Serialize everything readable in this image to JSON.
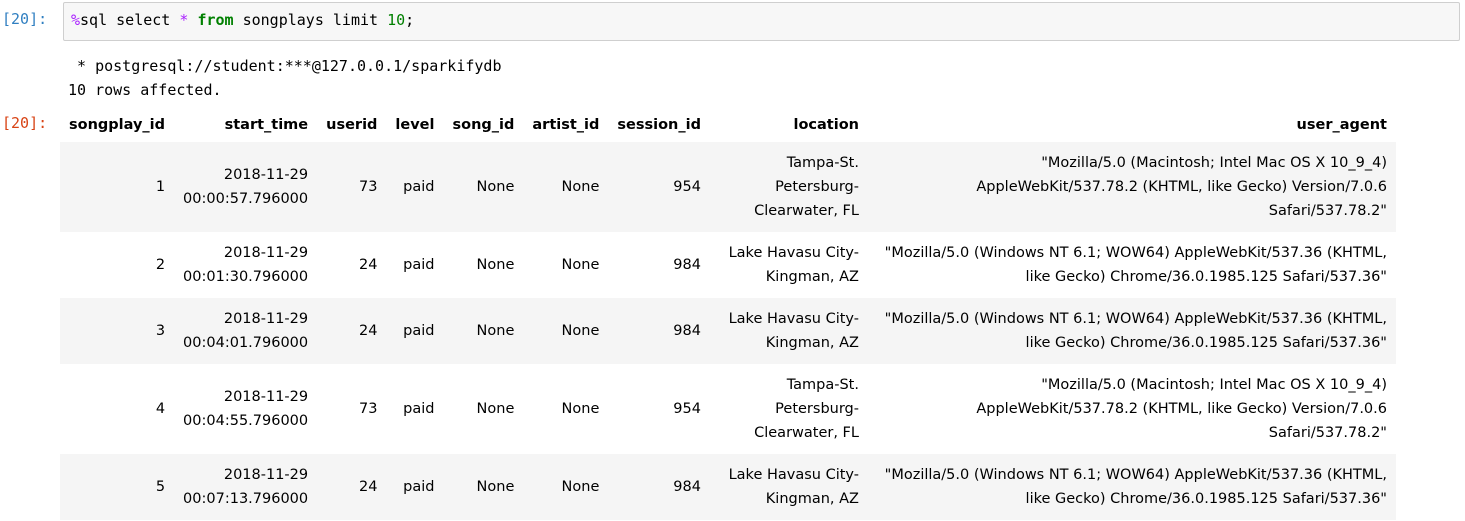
{
  "input_cell": {
    "prompt": "[20]:",
    "code_tokens": [
      {
        "cls": "tk-magic",
        "text": "%"
      },
      {
        "cls": "",
        "text": "sql select "
      },
      {
        "cls": "tk-op",
        "text": "*"
      },
      {
        "cls": "",
        "text": " "
      },
      {
        "cls": "tk-kw",
        "text": "from"
      },
      {
        "cls": "",
        "text": " songplays limit "
      },
      {
        "cls": "tk-num",
        "text": "10"
      },
      {
        "cls": "",
        "text": ";"
      }
    ]
  },
  "output_cell": {
    "prompt": "[20]:",
    "connection": " * postgresql://student:***@127.0.0.1/sparkifydb",
    "rows_affected": "10 rows affected."
  },
  "table": {
    "columns": [
      "songplay_id",
      "start_time",
      "userid",
      "level",
      "song_id",
      "artist_id",
      "session_id",
      "location",
      "user_agent"
    ],
    "rows": [
      {
        "lines": 3,
        "cells": [
          "1",
          "2018-11-29 00:00:57.796000",
          "73",
          "paid",
          "None",
          "None",
          "954",
          "Tampa-St. Petersburg-Clearwater, FL",
          "\"Mozilla/5.0 (Macintosh; Intel Mac OS X 10_9_4) AppleWebKit/537.78.2 (KHTML, like Gecko) Version/7.0.6 Safari/537.78.2\""
        ]
      },
      {
        "lines": 2,
        "cells": [
          "2",
          "2018-11-29 00:01:30.796000",
          "24",
          "paid",
          "None",
          "None",
          "984",
          "Lake Havasu City-Kingman, AZ",
          "\"Mozilla/5.0 (Windows NT 6.1; WOW64) AppleWebKit/537.36 (KHTML, like Gecko) Chrome/36.0.1985.125 Safari/537.36\""
        ]
      },
      {
        "lines": 2,
        "cells": [
          "3",
          "2018-11-29 00:04:01.796000",
          "24",
          "paid",
          "None",
          "None",
          "984",
          "Lake Havasu City-Kingman, AZ",
          "\"Mozilla/5.0 (Windows NT 6.1; WOW64) AppleWebKit/537.36 (KHTML, like Gecko) Chrome/36.0.1985.125 Safari/537.36\""
        ]
      },
      {
        "lines": 3,
        "cells": [
          "4",
          "2018-11-29 00:04:55.796000",
          "73",
          "paid",
          "None",
          "None",
          "954",
          "Tampa-St. Petersburg-Clearwater, FL",
          "\"Mozilla/5.0 (Macintosh; Intel Mac OS X 10_9_4) AppleWebKit/537.78.2 (KHTML, like Gecko) Version/7.0.6 Safari/537.78.2\""
        ]
      },
      {
        "lines": 2,
        "cells": [
          "5",
          "2018-11-29 00:07:13.796000",
          "24",
          "paid",
          "None",
          "None",
          "984",
          "Lake Havasu City-Kingman, AZ",
          "\"Mozilla/5.0 (Windows NT 6.1; WOW64) AppleWebKit/537.36 (KHTML, like Gecko) Chrome/36.0.1985.125 Safari/537.36\""
        ]
      }
    ]
  }
}
